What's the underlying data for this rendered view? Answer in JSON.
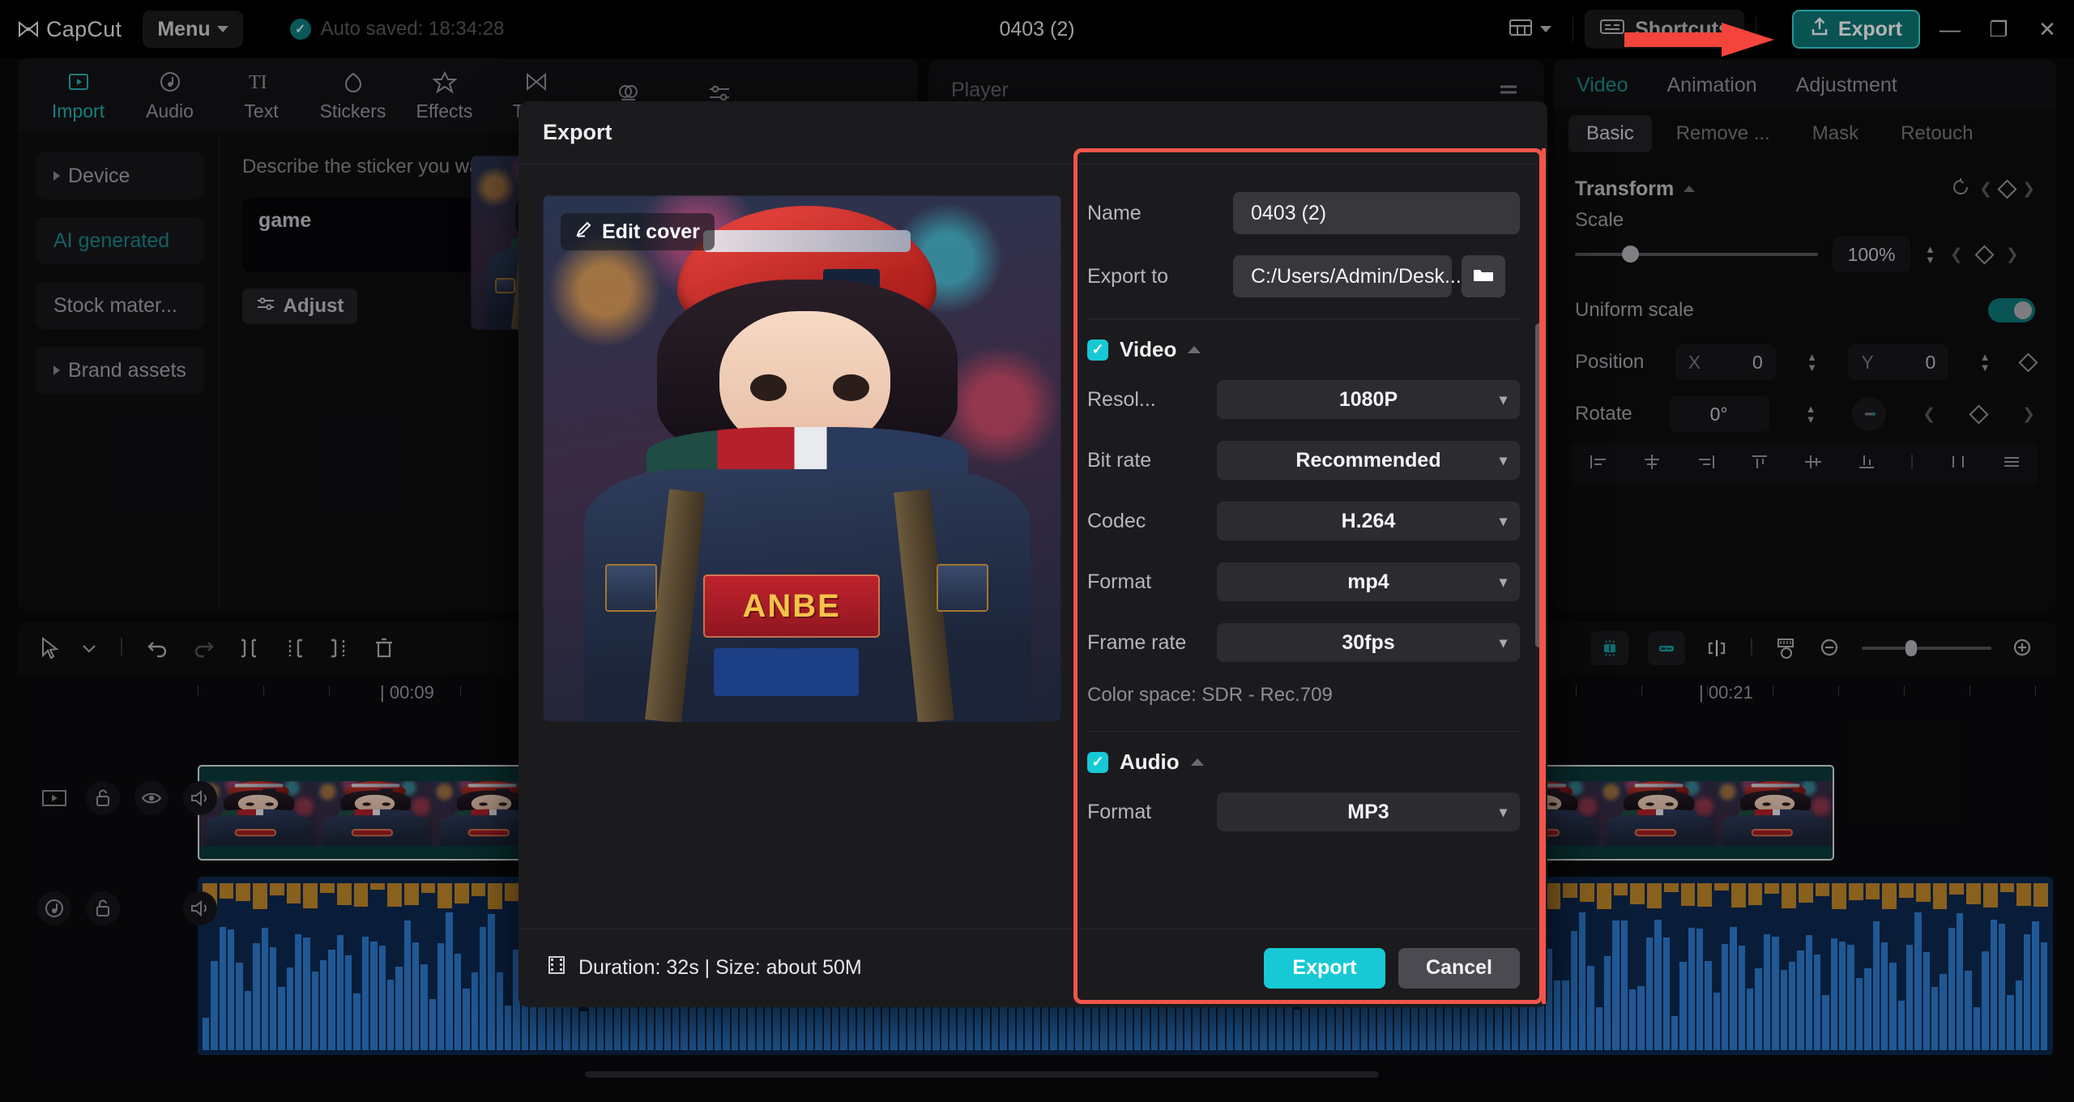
{
  "titlebar": {
    "app_name": "CapCut",
    "menu_label": "Menu",
    "autosave": "Auto saved: 18:34:28",
    "project_title": "0403 (2)",
    "layout_icon": "layout-grid-icon",
    "shortcuts_label": "Shortcuts",
    "shortcuts_icon": "keyboard-icon",
    "export_label": "Export",
    "export_icon": "share-upload-icon",
    "minimize": "—",
    "maximize": "❐",
    "close": "✕",
    "accent_teal": "#0e7878",
    "highlight_red": "#f1554c"
  },
  "tool_tabs": [
    {
      "label": "Import",
      "icon": "media-play-icon",
      "active": true
    },
    {
      "label": "Audio",
      "icon": "audio-note-icon",
      "active": false
    },
    {
      "label": "Text",
      "icon": "text-ti-icon",
      "active": false
    },
    {
      "label": "Stickers",
      "icon": "sticker-drop-icon",
      "active": false
    },
    {
      "label": "Effects",
      "icon": "sparkle-star-icon",
      "active": false
    },
    {
      "label": "Trans",
      "icon": "transition-bowtie-icon",
      "active": false
    },
    {
      "label": "",
      "icon": "filters-icon",
      "active": false
    },
    {
      "label": "",
      "icon": "adjustment-sliders-icon",
      "active": false
    }
  ],
  "left_panel": {
    "nav_items": [
      {
        "label": "Device",
        "expandable": true,
        "selected": false
      },
      {
        "label": "AI generated",
        "expandable": false,
        "selected": true
      },
      {
        "label": "Stock mater...",
        "expandable": false,
        "selected": false
      },
      {
        "label": "Brand assets",
        "expandable": true,
        "selected": false
      }
    ],
    "sticker_hint": "Describe the sticker you want to",
    "prompt_value": "game",
    "prompt_placeholder": "Describe the sticker you want to generate",
    "adjust_label": "Adjust",
    "adjust_icon": "sliders-icon"
  },
  "player": {
    "title": "Player",
    "menu_icon": "hamburger-icon"
  },
  "right_panel": {
    "tabs": [
      {
        "label": "Video",
        "active": true
      },
      {
        "label": "Animation",
        "active": false
      },
      {
        "label": "Adjustment",
        "active": false
      }
    ],
    "subtabs": [
      {
        "label": "Basic",
        "active": true
      },
      {
        "label": "Remove ...",
        "active": false
      },
      {
        "label": "Mask",
        "active": false
      },
      {
        "label": "Retouch",
        "active": false
      }
    ],
    "section_title": "Transform",
    "reset_icon": "reset-circle-icon",
    "keyframe_icon": "keyframe-diamond-icon",
    "scale_label": "Scale",
    "scale_value": "100%",
    "uniform_scale_label": "Uniform scale",
    "uniform_scale_on": true,
    "position_label": "Position",
    "position_x_axis": "X",
    "position_x_value": "0",
    "position_y_axis": "Y",
    "position_y_value": "0",
    "rotate_label": "Rotate",
    "rotate_value": "0°",
    "align_icons": [
      "align-left-icon",
      "align-center-horizontal-icon",
      "align-right-icon",
      "align-top-icon",
      "align-middle-vertical-icon",
      "align-bottom-icon",
      "distribute-horizontal-icon",
      "distribute-vertical-icon"
    ]
  },
  "timeline": {
    "tools_left": [
      "select-cursor-icon",
      "chevron-down-icon",
      "undo-icon",
      "redo-icon",
      "split-icon",
      "trim-left-icon",
      "trim-right-icon",
      "delete-trash-icon"
    ],
    "tools_right": [
      "auto-cut-icon",
      "link-clip-icon",
      "snap-magnet-icon",
      "ruler-measure-icon",
      "zoom-out-icon",
      "zoom-in-icon"
    ],
    "ruler_labels": [
      "| 00:09",
      "| 00:21"
    ],
    "track_video_controls": [
      "media-play-icon",
      "unlock-icon",
      "eye-icon",
      "volume-icon"
    ],
    "track_audio_controls": [
      "audio-note-icon",
      "unlock-icon",
      "volume-icon"
    ]
  },
  "export_dialog": {
    "title": "Export",
    "edit_cover_label": "Edit cover",
    "edit_cover_icon": "pencil-edit-icon",
    "cover_badge_text": "ANBE",
    "name_label": "Name",
    "name_value": "0403 (2)",
    "export_to_label": "Export to",
    "export_to_value": "C:/Users/Admin/Desk...",
    "folder_icon": "folder-icon",
    "video_section": {
      "label": "Video",
      "checked": true,
      "rows": [
        {
          "label": "Resol...",
          "value": "1080P"
        },
        {
          "label": "Bit rate",
          "value": "Recommended"
        },
        {
          "label": "Codec",
          "value": "H.264"
        },
        {
          "label": "Format",
          "value": "mp4"
        },
        {
          "label": "Frame rate",
          "value": "30fps"
        }
      ],
      "color_space": "Color space: SDR - Rec.709"
    },
    "audio_section": {
      "label": "Audio",
      "checked": true,
      "rows": [
        {
          "label": "Format",
          "value": "MP3"
        }
      ]
    },
    "footer": {
      "info": "Duration: 32s | Size: about 50M",
      "info_icon": "film-strip-icon",
      "export_label": "Export",
      "cancel_label": "Cancel"
    }
  }
}
